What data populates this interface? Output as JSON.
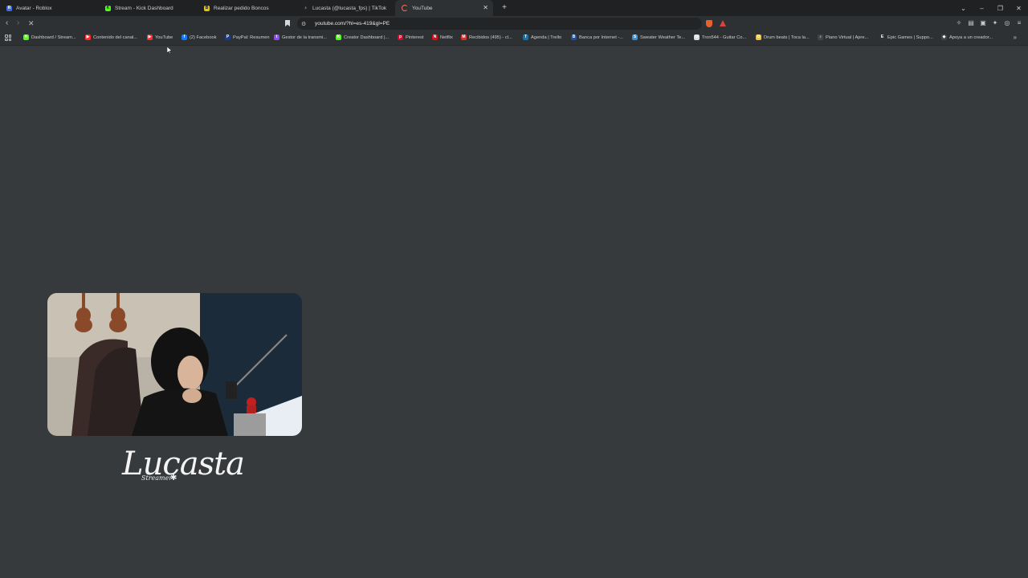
{
  "tabs": [
    {
      "title": "Avatar - Roblox",
      "icon": "roblox-icon",
      "color": "#3b6fe0",
      "glyph": "R"
    },
    {
      "title": "Stream - Kick Dashboard",
      "icon": "kick-icon",
      "color": "#53fc18",
      "glyph": "K"
    },
    {
      "title": "Realizar pedido Boncos",
      "icon": "boncos-icon",
      "color": "#e0c21a",
      "glyph": "B"
    },
    {
      "title": "Lucasta (@lucasta_fps) | TikTok",
      "icon": "tiktok-icon",
      "color": "#222222",
      "glyph": "♪"
    },
    {
      "title": "YouTube",
      "icon": "youtube-icon",
      "color": "#ff2a2a",
      "glyph": "▶",
      "active": true
    }
  ],
  "new_tab": "+",
  "address": {
    "url": "youtube.com/?hl=es-419&gl=PE"
  },
  "bookmarks": [
    {
      "label": "Dashboard / Stream...",
      "color": "#53fc18",
      "glyph": "K"
    },
    {
      "label": "Contenido del canal...",
      "color": "#ff2a2a",
      "glyph": "▶"
    },
    {
      "label": "YouTube",
      "color": "#ff2a2a",
      "glyph": "▶"
    },
    {
      "label": "(2) Facebook",
      "color": "#1877f2",
      "glyph": "f"
    },
    {
      "label": "PayPal: Resumen",
      "color": "#1a3d8f",
      "glyph": "P"
    },
    {
      "label": "Gestor de la transmi...",
      "color": "#9146ff",
      "glyph": "t"
    },
    {
      "label": "Creator Dashboard |...",
      "color": "#53fc18",
      "glyph": "K"
    },
    {
      "label": "Pinterest",
      "color": "#e60023",
      "glyph": "p"
    },
    {
      "label": "Netflix",
      "color": "#e50914",
      "glyph": "N"
    },
    {
      "label": "Recibidos (495) - cl...",
      "color": "#d93025",
      "glyph": "M"
    },
    {
      "label": "Agenda | Trello",
      "color": "#0079bf",
      "glyph": "T"
    },
    {
      "label": "Banca por Internet -...",
      "color": "#1e4fa3",
      "glyph": "B"
    },
    {
      "label": "Sweater Weather Te...",
      "color": "#3a8fd6",
      "glyph": "S"
    },
    {
      "label": "Tron544 - Guitar Co...",
      "color": "#dddddd",
      "glyph": "G"
    },
    {
      "label": "Drum beats | Toca la...",
      "color": "#f2c230",
      "glyph": "D"
    },
    {
      "label": "Piano Virtual | Apre...",
      "color": "#444444",
      "glyph": "♪"
    },
    {
      "label": "Epic Games | Suppo...",
      "color": "#333333",
      "glyph": "E"
    },
    {
      "label": "Apoya a un creador...",
      "color": "#444444",
      "glyph": "◆"
    }
  ],
  "logo": {
    "main": "Lucasta",
    "sub": "Streamer"
  }
}
